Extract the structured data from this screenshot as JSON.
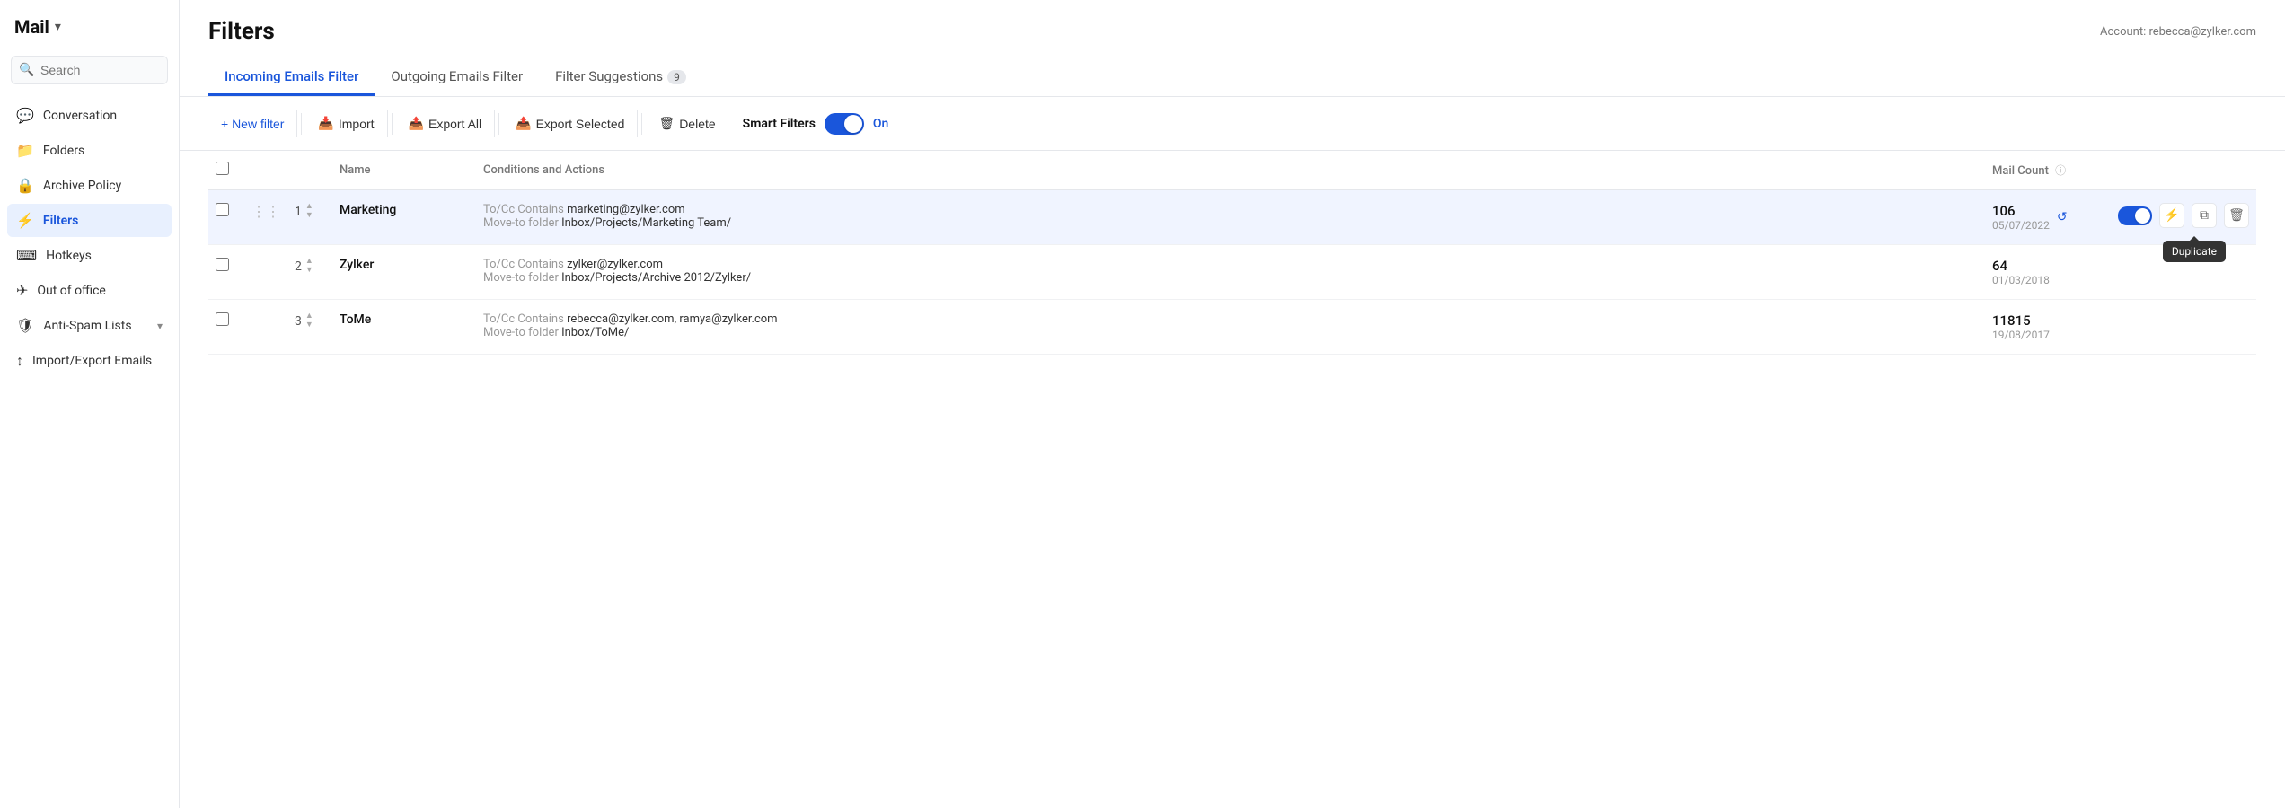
{
  "sidebar": {
    "title": "Mail",
    "search_placeholder": "Search",
    "nav_items": [
      {
        "id": "conversation",
        "label": "Conversation",
        "icon": "💬",
        "active": false
      },
      {
        "id": "folders",
        "label": "Folders",
        "icon": "📁",
        "active": false
      },
      {
        "id": "archive-policy",
        "label": "Archive Policy",
        "icon": "🔒",
        "active": false
      },
      {
        "id": "filters",
        "label": "Filters",
        "icon": "⚡",
        "active": true
      },
      {
        "id": "hotkeys",
        "label": "Hotkeys",
        "icon": "⌨",
        "active": false
      },
      {
        "id": "out-of-office",
        "label": "Out of office",
        "icon": "✈",
        "active": false
      },
      {
        "id": "anti-spam",
        "label": "Anti-Spam Lists",
        "icon": "🛡",
        "active": false,
        "has_chevron": true
      },
      {
        "id": "import-export",
        "label": "Import/Export Emails",
        "icon": "↕",
        "active": false
      }
    ]
  },
  "header": {
    "page_title": "Filters",
    "account_label": "Account:",
    "account_email": "rebecca@zylker.com"
  },
  "tabs": [
    {
      "id": "incoming",
      "label": "Incoming Emails Filter",
      "active": true
    },
    {
      "id": "outgoing",
      "label": "Outgoing Emails Filter",
      "active": false
    },
    {
      "id": "suggestions",
      "label": "Filter Suggestions",
      "badge": "9",
      "active": false
    }
  ],
  "toolbar": {
    "new_filter": "+ New filter",
    "import": "Import",
    "export_all": "Export All",
    "export_selected": "Export Selected",
    "delete": "Delete",
    "smart_filters_label": "Smart Filters",
    "smart_filters_state": "On"
  },
  "table": {
    "columns": {
      "name": "Name",
      "conditions": "Conditions and Actions",
      "mail_count": "Mail Count"
    },
    "rows": [
      {
        "id": 1,
        "num": "1",
        "name": "Marketing",
        "condition_label": "To/Cc Contains",
        "condition_value": "marketing@zylker.com",
        "action_label": "Move-to folder",
        "action_value": "Inbox/Projects/Marketing Team/",
        "mail_count": "106",
        "mail_date": "05/07/2022",
        "enabled": true,
        "highlighted": true,
        "has_undo": true,
        "show_tooltip": true,
        "tooltip_text": "Duplicate"
      },
      {
        "id": 2,
        "num": "2",
        "name": "Zylker",
        "condition_label": "To/Cc Contains",
        "condition_value": "zylker@zylker.com",
        "action_label": "Move-to folder",
        "action_value": "Inbox/Projects/Archive 2012/Zylker/",
        "mail_count": "64",
        "mail_date": "01/03/2018",
        "enabled": false,
        "highlighted": false,
        "has_undo": false,
        "show_tooltip": false
      },
      {
        "id": 3,
        "num": "3",
        "name": "ToMe",
        "condition_label": "To/Cc Contains",
        "condition_value": "rebecca@zylker.com, ramya@zylker.com",
        "action_label": "Move-to folder",
        "action_value": "Inbox/ToMe/",
        "mail_count": "11815",
        "mail_date": "19/08/2017",
        "enabled": false,
        "highlighted": false,
        "has_undo": false,
        "show_tooltip": false
      }
    ]
  }
}
